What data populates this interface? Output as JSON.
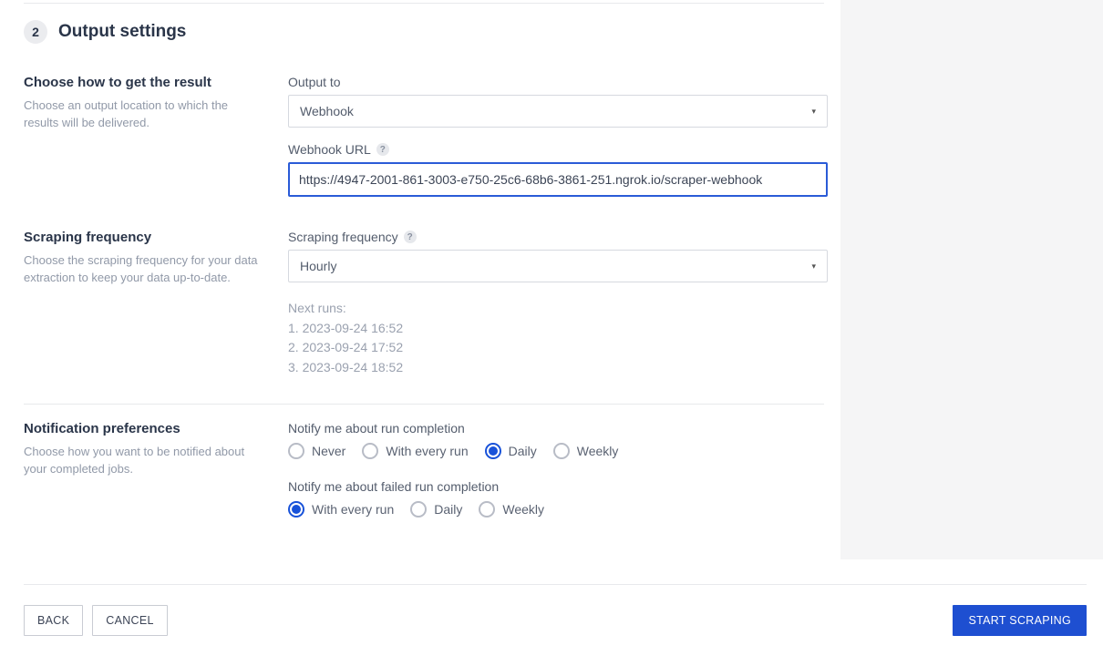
{
  "step": {
    "number": "2",
    "title": "Output settings"
  },
  "output": {
    "title": "Choose how to get the result",
    "desc": "Choose an output location to which the results will be delivered.",
    "output_to_label": "Output to",
    "output_to_value": "Webhook",
    "webhook_label": "Webhook URL",
    "webhook_value": "https://4947-2001-861-3003-e750-25c6-68b6-3861-251.ngrok.io/scraper-webhook"
  },
  "frequency": {
    "title": "Scraping frequency",
    "desc": "Choose the scraping frequency for your data extraction to keep your data up-to-date.",
    "label": "Scraping frequency",
    "value": "Hourly",
    "next_runs_label": "Next runs:",
    "next_runs": [
      "1. 2023-09-24 16:52",
      "2. 2023-09-24 17:52",
      "3. 2023-09-24 18:52"
    ]
  },
  "notifications": {
    "title": "Notification preferences",
    "desc": "Choose how you want to be notified about your completed jobs.",
    "completion_label": "Notify me about run completion",
    "completion_options": [
      {
        "label": "Never",
        "checked": false
      },
      {
        "label": "With every run",
        "checked": false
      },
      {
        "label": "Daily",
        "checked": true
      },
      {
        "label": "Weekly",
        "checked": false
      }
    ],
    "failed_label": "Notify me about failed run completion",
    "failed_options": [
      {
        "label": "With every run",
        "checked": true
      },
      {
        "label": "Daily",
        "checked": false
      },
      {
        "label": "Weekly",
        "checked": false
      }
    ]
  },
  "footer": {
    "back": "BACK",
    "cancel": "CANCEL",
    "start": "START SCRAPING"
  }
}
